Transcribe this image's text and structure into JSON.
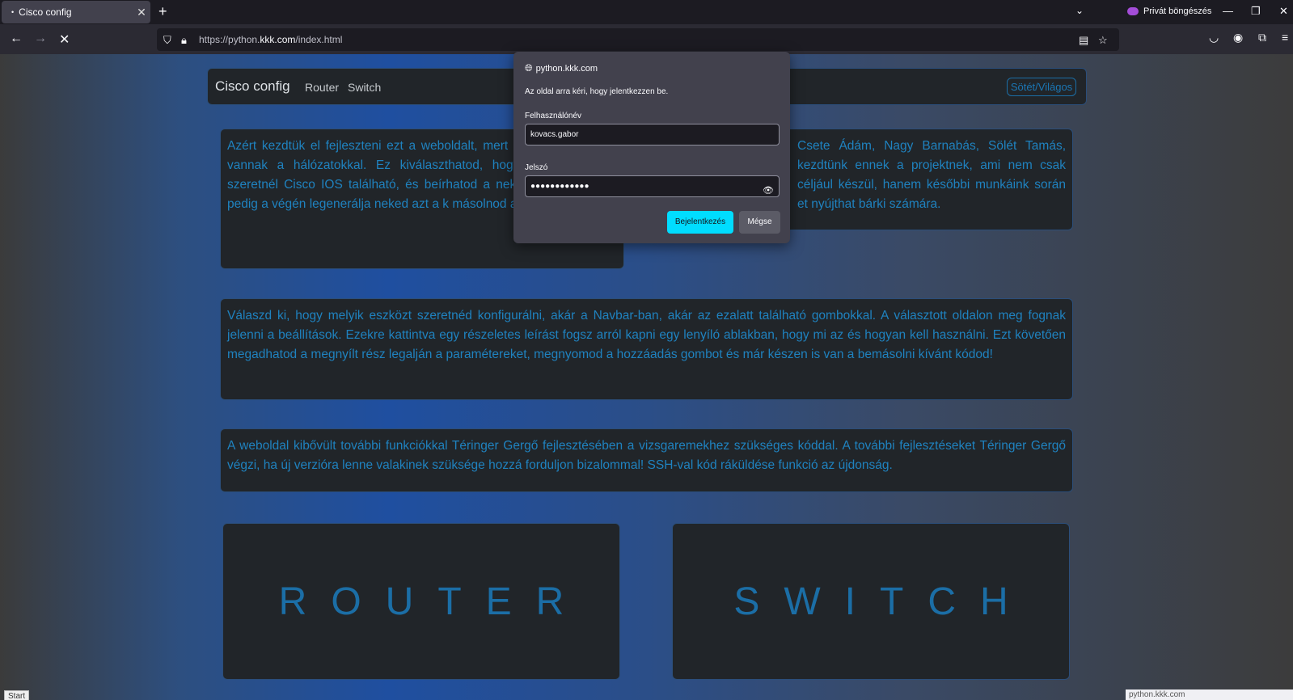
{
  "browser": {
    "tab_title": "Cisco config",
    "url_prefix": "https://python.",
    "url_domain": "kkk.com",
    "url_path": "/index.html",
    "private_label": "Privát böngészés"
  },
  "site": {
    "brand": "Cisco config",
    "nav_router": "Router",
    "nav_switch": "Switch",
    "theme_toggle": "Sötét/Világos",
    "card1_left": "Azért kezdtük el fejleszteni ezt a weboldalt, mert diáknak problémái vannak a hálózatokkal. Ez kiválaszthatod, hogy milyen eszközt szeretnél Cisco IOS található, és beírhatod a neked szük weboldal pedig a végén legenerálja neked azt a k másolnod az adott eszközbe.",
    "card1_right": "Csete Ádám, Nagy Barnabás, Sölét Tamás, kezdtünk ennek a projektnek, ami nem csak céljául készül, hanem későbbi munkáink során et nyújthat bárki számára.",
    "card2": "Válaszd ki, hogy melyik eszközt szeretnéd konfigurálni, akár a Navbar-ban, akár az ezalatt található gombokkal. A választott oldalon meg fognak jelenni a beállítások. Ezekre kattintva egy részeletes leírást fogsz arról kapni egy lenyíló ablakban, hogy mi az és hogyan kell használni. Ezt követően megadhatod a megnyílt rész legalján a paramétereket, megnyomod a hozzáadás gombot és már készen is van a bemásolni kívánt kódod!",
    "card3": "A weboldal kibővült további funkciókkal Téringer Gergő fejlesztésében a vizsgaremekhez szükséges kóddal. A további fejlesztéseket Téringer Gergő végzi, ha új verzióra lenne valakinek szüksége hozzá forduljon bizalommal! SSH-val kód ráküldése funkció az újdonság.",
    "router_button": "ROUTER",
    "switch_button": "SWITCH"
  },
  "dialog": {
    "host": "python.kkk.com",
    "message": "Az oldal arra kéri, hogy jelentkezzen be.",
    "username_label": "Felhasználónév",
    "username_value": "kovacs.gabor",
    "password_label": "Jelszó",
    "password_value": "●●●●●●●●●●●●",
    "login_button": "Bejelentkezés",
    "cancel_button": "Mégse"
  },
  "status": {
    "start_label": "Start",
    "status_url": "python.kkk.com"
  },
  "colors": {
    "accent": "#00ddff",
    "text_blue": "#1f82bf"
  }
}
